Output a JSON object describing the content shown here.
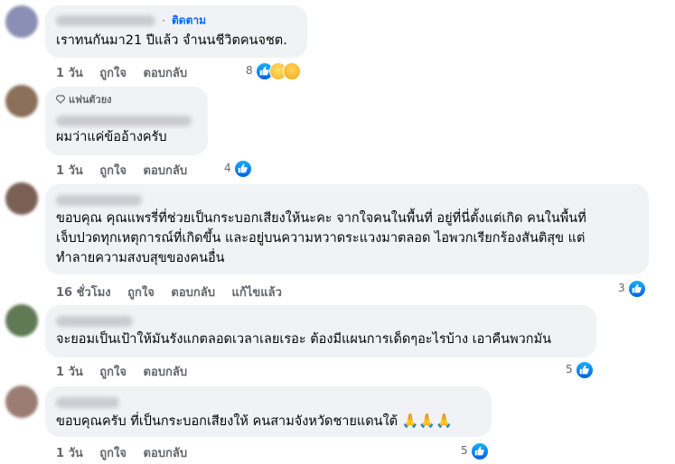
{
  "comments": [
    {
      "follow_label": "ติดตาม",
      "dot": "·",
      "text": "เราทนกันมา21 ปีแล้ว จำนนชีวิตคนจชต.",
      "time": "1 วัน",
      "like_label": "ถูกใจ",
      "reply_label": "ตอบกลับ",
      "reaction_count": "8",
      "reactions": [
        "like-icon",
        "sad-icon",
        "care-icon"
      ],
      "avatar_color": "#8b8fb3"
    },
    {
      "badge_label": "แฟนตัวยง",
      "text": "ผมว่าแค่ข้ออ้างครับ",
      "time": "1 วัน",
      "like_label": "ถูกใจ",
      "reply_label": "ตอบกลับ",
      "reaction_count": "4",
      "reactions": [
        "like-icon"
      ],
      "avatar_color": "#8a6f5a"
    },
    {
      "text_lines": [
        "ขอบคุณ คุณแพรรี่ที่ช่วยเป็นกระบอกเสียงให้นะคะ จากใจคนในพื้นที่ อยู่ที่นี่ตั้งแต่เกิด คนในพื้นที่",
        "เจ็บปวดทุกเหตุการณ์ที่เกิดขึ้น และอยู่บนความหวาดระแวงมาตลอด ไอพวกเรียกร้องสันติสุข แต่",
        "ทำลายความสงบสุขของคนอื่น"
      ],
      "time": "16 ชั่วโมง",
      "like_label": "ถูกใจ",
      "reply_label": "ตอบกลับ",
      "edited_label": "แก้ไขแล้ว",
      "reaction_count": "3",
      "reactions": [
        "like-icon"
      ],
      "avatar_color": "#7a5f55"
    },
    {
      "text": "จะยอมเป็นเป้าให้มันรังแกตลอดเวลาเลยเรอะ ต้องมีแผนการเด็ดๆอะไรบ้าง เอาคืนพวกมัน",
      "time": "1 วัน",
      "like_label": "ถูกใจ",
      "reply_label": "ตอบกลับ",
      "reaction_count": "5",
      "reactions": [
        "like-icon"
      ],
      "avatar_color": "#5f7a55"
    },
    {
      "text": "ขอบคุณครับ ที่เป็นกระบอกเสียงให้ คนสามจังหวัดชายแดนใต้",
      "emoji": "🙏🙏🙏",
      "time": "1 วัน",
      "like_label": "ถูกใจ",
      "reply_label": "ตอบกลับ",
      "reaction_count": "5",
      "reactions": [
        "like-icon"
      ],
      "avatar_color": "#9a7c72"
    }
  ]
}
